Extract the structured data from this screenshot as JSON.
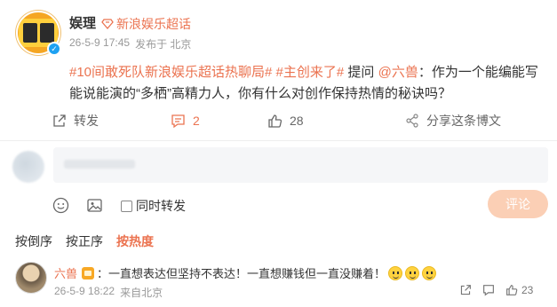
{
  "post": {
    "author": "娱理",
    "topic_tag": "新浪娱乐超话",
    "timestamp": "26-5-9 17:45",
    "source": "发布于 北京",
    "hashtag_1": "#10间敢死队新浪娱乐超话热聊局#",
    "hashtag_2": "#主创来了#",
    "prefix": "提问",
    "mention": "@六兽",
    "body": "：作为一个能编能写能说能演的“多栖”高精力人，你有什么对创作保持热情的秘诀吗？"
  },
  "actions": {
    "forward_label": "转发",
    "comment_count": "2",
    "like_count": "28",
    "share_label": "分享这条博文"
  },
  "composer": {
    "repost_label": "同时转发",
    "submit_label": "评论"
  },
  "sort": {
    "options": [
      "按倒序",
      "按正序",
      "按热度"
    ],
    "active": "按热度"
  },
  "comment": {
    "author": "六兽",
    "text": "：一直想表达但坚持不表达！一直想赚钱但一直没赚着！",
    "timestamp": "26-5-9 18:22",
    "source": "来自北京",
    "like_count": "23"
  },
  "colors": {
    "accent": "#eb7350",
    "submit_disabled": "#fbcfb5",
    "verified": "#1da1f2"
  }
}
